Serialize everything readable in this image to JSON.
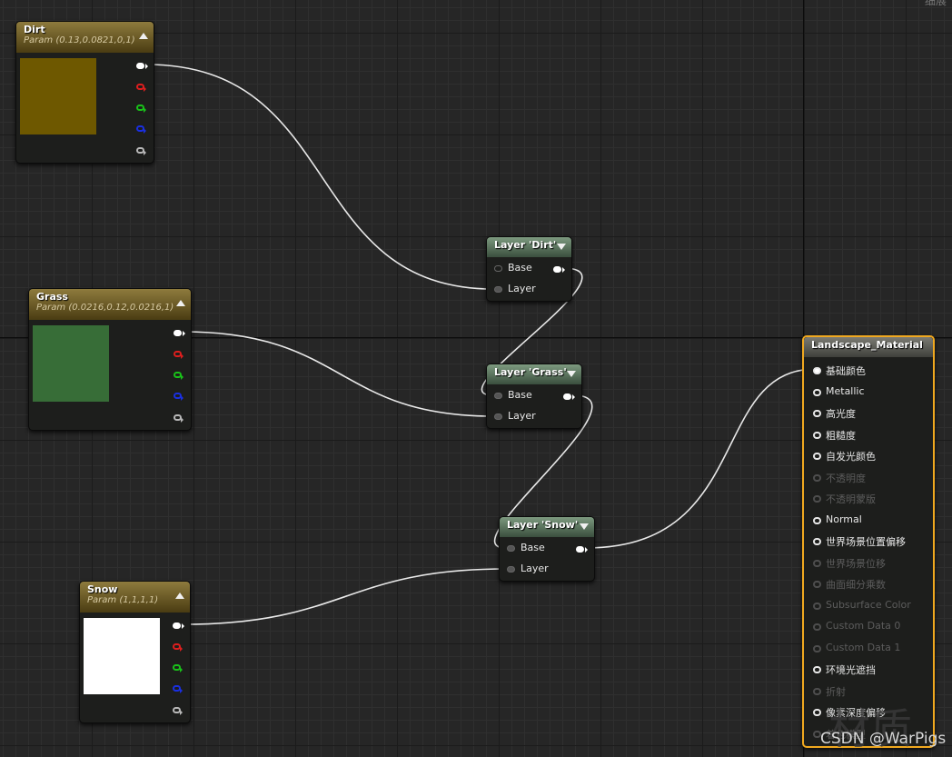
{
  "header": {
    "corner_label": "细展"
  },
  "colors": {
    "dirt_swatch": "#6e5800",
    "grass_swatch": "#376d37",
    "snow_swatch": "#ffffff",
    "material_border": "#f0a81f",
    "wire": "#e8e8e8"
  },
  "param_nodes": [
    {
      "title": "Dirt",
      "subtitle": "Param (0.13,0.0821,0,1)"
    },
    {
      "title": "Grass",
      "subtitle": "Param (0.0216,0.12,0.0216,1)"
    },
    {
      "title": "Snow",
      "subtitle": "Param (1,1,1,1)"
    }
  ],
  "layer_nodes": [
    {
      "title": "Layer 'Dirt'",
      "inputs": [
        "Base",
        "Layer"
      ]
    },
    {
      "title": "Layer 'Grass'",
      "inputs": [
        "Base",
        "Layer"
      ]
    },
    {
      "title": "Layer 'Snow'",
      "inputs": [
        "Base",
        "Layer"
      ]
    }
  ],
  "material_node": {
    "title": "Landscape_Material",
    "inputs": [
      {
        "label": "基础颜色",
        "enabled": true,
        "connected": true
      },
      {
        "label": "Metallic",
        "enabled": true,
        "connected": false
      },
      {
        "label": "高光度",
        "enabled": true,
        "connected": false
      },
      {
        "label": "粗糙度",
        "enabled": true,
        "connected": false
      },
      {
        "label": "自发光颜色",
        "enabled": true,
        "connected": false
      },
      {
        "label": "不透明度",
        "enabled": false,
        "connected": false
      },
      {
        "label": "不透明蒙版",
        "enabled": false,
        "connected": false
      },
      {
        "label": "Normal",
        "enabled": true,
        "connected": false
      },
      {
        "label": "世界场景位置偏移",
        "enabled": true,
        "connected": false
      },
      {
        "label": "世界场景位移",
        "enabled": false,
        "connected": false
      },
      {
        "label": "曲面细分乘数",
        "enabled": false,
        "connected": false
      },
      {
        "label": "Subsurface Color",
        "enabled": false,
        "connected": false
      },
      {
        "label": "Custom Data 0",
        "enabled": false,
        "connected": false
      },
      {
        "label": "Custom Data 1",
        "enabled": false,
        "connected": false
      },
      {
        "label": "环境光遮挡",
        "enabled": true,
        "connected": false
      },
      {
        "label": "折射",
        "enabled": false,
        "connected": false
      },
      {
        "label": "像素深度偏移",
        "enabled": true,
        "connected": false
      },
      {
        "label": "着色模型",
        "enabled": false,
        "connected": false
      }
    ]
  },
  "watermark": {
    "big_text": "材质",
    "text": "CSDN @WarPigs"
  }
}
